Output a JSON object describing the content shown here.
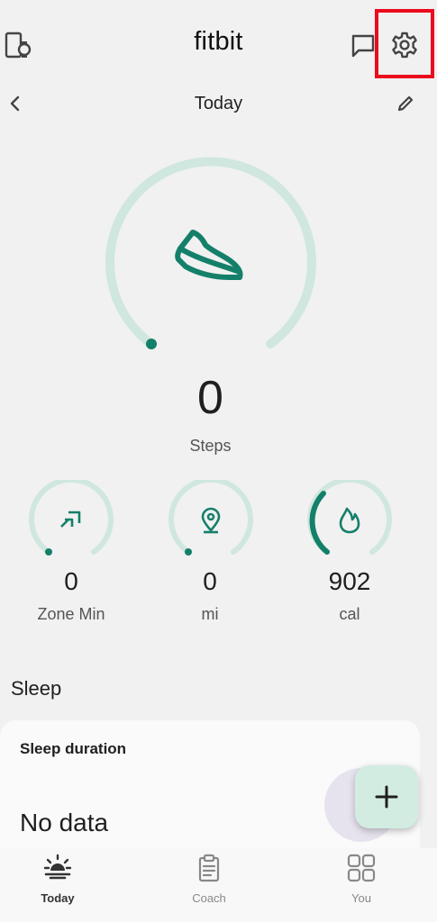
{
  "header": {
    "brand": "fitbit"
  },
  "datebar": {
    "title": "Today"
  },
  "steps": {
    "value": "0",
    "label": "Steps",
    "progress": 0.0
  },
  "stats": [
    {
      "value": "0",
      "label": "Zone Min",
      "progress": 0.0,
      "icon": "zone-arrows-icon"
    },
    {
      "value": "0",
      "label": "mi",
      "progress": 0.0,
      "icon": "location-pin-icon"
    },
    {
      "value": "902",
      "label": "cal",
      "progress": 0.3,
      "icon": "flame-icon"
    }
  ],
  "sleep": {
    "section_title": "Sleep",
    "card_title": "Sleep duration",
    "value": "No data"
  },
  "bottom_nav": {
    "items": [
      {
        "label": "Today",
        "active": true,
        "icon": "today-sunrise-icon"
      },
      {
        "label": "Coach",
        "active": false,
        "icon": "clipboard-icon"
      },
      {
        "label": "You",
        "active": false,
        "icon": "grid-icon"
      }
    ]
  },
  "colors": {
    "accent": "#14806a",
    "track": "#cfe7df",
    "highlight": "#ea0b1d",
    "background": "#f1f1f1"
  }
}
